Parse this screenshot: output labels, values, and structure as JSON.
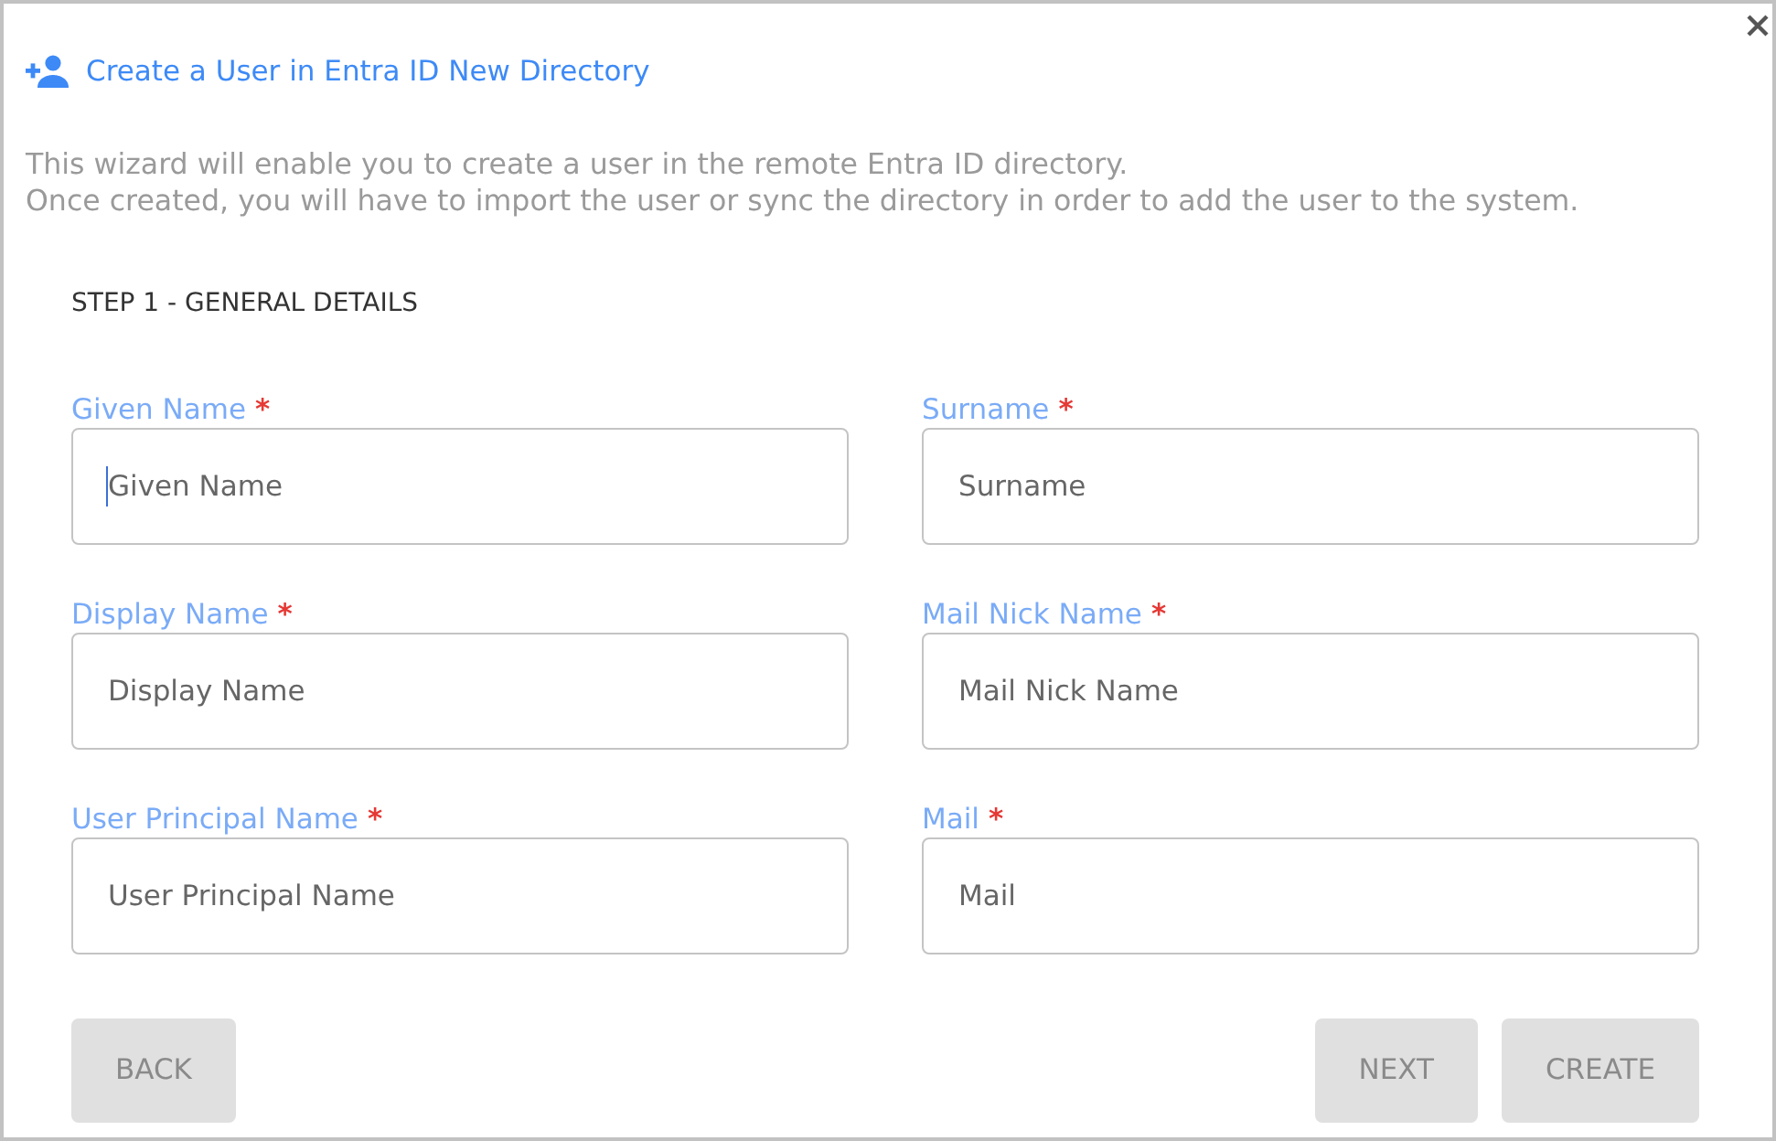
{
  "dialog": {
    "title": "Create a User in Entra ID New Directory",
    "description": [
      "This wizard will enable you to create a user in the remote Entra ID directory.",
      "Once created, you will have to import the user or sync the directory in order to add the user to the system."
    ],
    "step_heading": "STEP 1 - GENERAL DETAILS",
    "fields": [
      {
        "label": "Given Name",
        "required_mark": "*",
        "placeholder": "Given Name",
        "focused": true
      },
      {
        "label": "Surname",
        "required_mark": "*",
        "placeholder": "Surname",
        "focused": false
      },
      {
        "label": "Display Name",
        "required_mark": "*",
        "placeholder": "Display Name",
        "focused": false
      },
      {
        "label": "Mail Nick Name",
        "required_mark": "*",
        "placeholder": "Mail Nick Name",
        "focused": false
      },
      {
        "label": "User Principal Name",
        "required_mark": "*",
        "placeholder": "User Principal Name",
        "focused": false
      },
      {
        "label": "Mail",
        "required_mark": "*",
        "placeholder": "Mail",
        "focused": false
      }
    ],
    "footer": {
      "left": [
        {
          "label": "BACK",
          "disabled": true
        }
      ],
      "right": [
        {
          "label": "NEXT",
          "disabled": true
        },
        {
          "label": "CREATE",
          "disabled": true
        }
      ]
    }
  }
}
